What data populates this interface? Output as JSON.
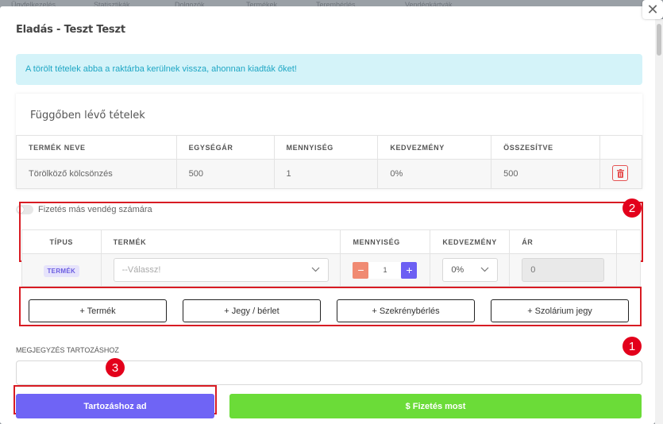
{
  "background_nav": [
    "Ügyfelkezelés",
    "Statisztikák",
    "Dolgozók",
    "Termékek",
    "Terembérlés",
    "Vendégkártyák"
  ],
  "modal": {
    "title": "Eladás - Teszt Teszt",
    "close_icon": "close-icon",
    "alert": "A törölt tételek abba a raktárba kerülnek vissza, ahonnan kiadták őket!"
  },
  "pending": {
    "title": "Függőben lévő tételek",
    "headers": [
      "TERMÉK NEVE",
      "EGYSÉGÁR",
      "MENNYISÉG",
      "KEDVEZMÉNY",
      "ÖSSZESÍTVE"
    ],
    "rows": [
      {
        "name": "Törölköző kölcsönzés",
        "unit_price": "500",
        "quantity": "1",
        "discount": "0%",
        "total": "500",
        "delete_icon": "trash-icon"
      }
    ]
  },
  "toggle": {
    "label": "Fizetés más vendég számára",
    "on": false
  },
  "items": {
    "headers": {
      "type": "TÍPUS",
      "product": "TERMÉK",
      "quantity": "MENNYISÉG",
      "discount": "KEDVEZMÉNY",
      "price": "ÁR"
    },
    "row": {
      "type_badge": "TERMÉK",
      "product_placeholder": "--Válassz!",
      "quantity": "1",
      "minus": "−",
      "plus": "+",
      "discount": "0%",
      "price": "0"
    }
  },
  "add_buttons": {
    "product": "+ Termék",
    "ticket": "+ Jegy / bérlet",
    "locker": "+ Szekrénybérlés",
    "solarium": "+ Szolárium jegy"
  },
  "note": {
    "label": "MEGJEGYZÉS TARTOZÁSHOZ",
    "value": ""
  },
  "actions": {
    "debt": "Tartozáshoz ad",
    "pay": "$  Fizetés most"
  },
  "annotations": {
    "badge1": "1",
    "badge2": "2",
    "badge3": "3"
  },
  "colors": {
    "primary": "#6f64f5",
    "success": "#6bdc38",
    "danger": "#e55353",
    "info_bg": "#d4f3f9",
    "highlight": "#d81b23"
  }
}
